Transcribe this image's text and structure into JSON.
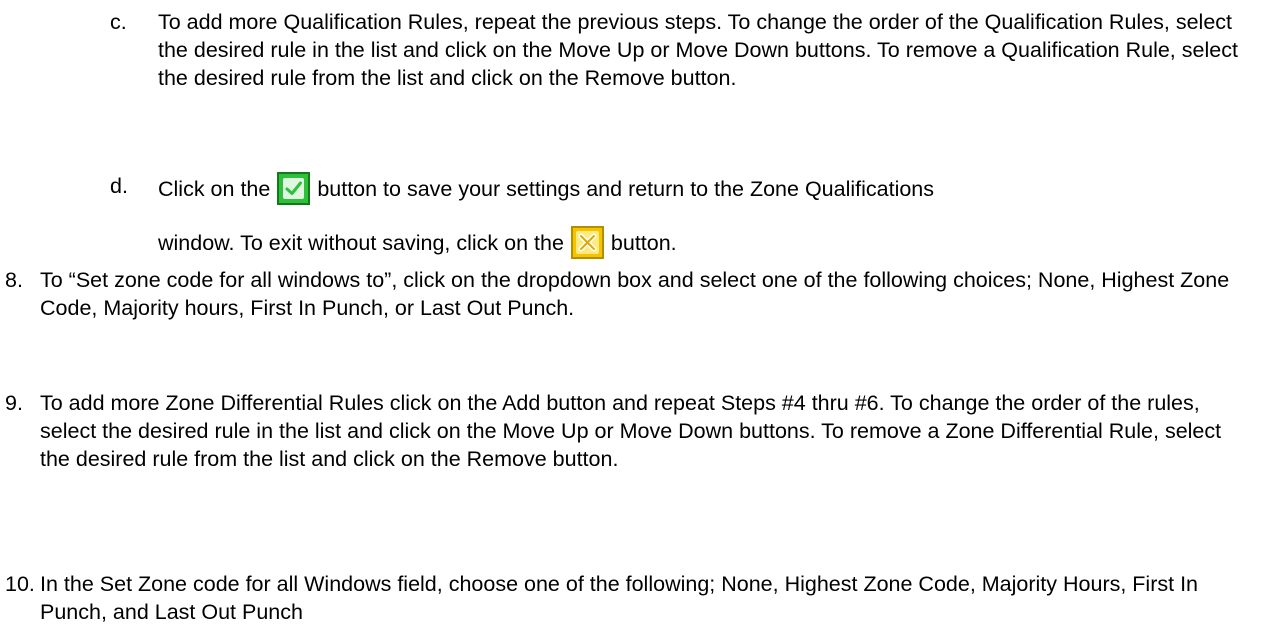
{
  "items": [
    {
      "marker": "c.",
      "text": "To add more Qualification Rules, repeat the previous steps. To change the order of the Qualification Rules, select the desired rule in the list and click on the Move Up or Move Down buttons. To remove a Qualification Rule, select the desired rule from the list and click on the Remove button."
    },
    {
      "marker": "d.",
      "text_before_check": "Click on the",
      "text_after_check": "button to save your settings and return to the Zone Qualifications",
      "text_before_cancel": "window. To exit without saving, click on the",
      "text_after_cancel": "button.",
      "check_icon": "checkmark-icon",
      "cancel_icon": "x-icon"
    },
    {
      "marker": "8.",
      "text": "To “Set zone code for all windows to”, click on the dropdown box and select one of the following choices; None, Highest Zone Code, Majority hours, First In Punch, or Last Out Punch."
    },
    {
      "marker": "9.",
      "text": "To add more Zone Differential Rules click on the Add button and repeat Steps #4 thru #6. To change the order of the rules, select the desired rule in the list and click on the Move Up or Move Down buttons. To remove a Zone Differential Rule, select the desired rule from the list and click on the Remove button."
    },
    {
      "marker": "10.",
      "text": "In the Set Zone code for all Windows field, choose one of the following; None, Highest Zone Code, Majority Hours, First In Punch, and Last Out Punch"
    }
  ],
  "colors": {
    "check_green": "#2fbf3a",
    "cancel_yellow": "#f5c400"
  }
}
